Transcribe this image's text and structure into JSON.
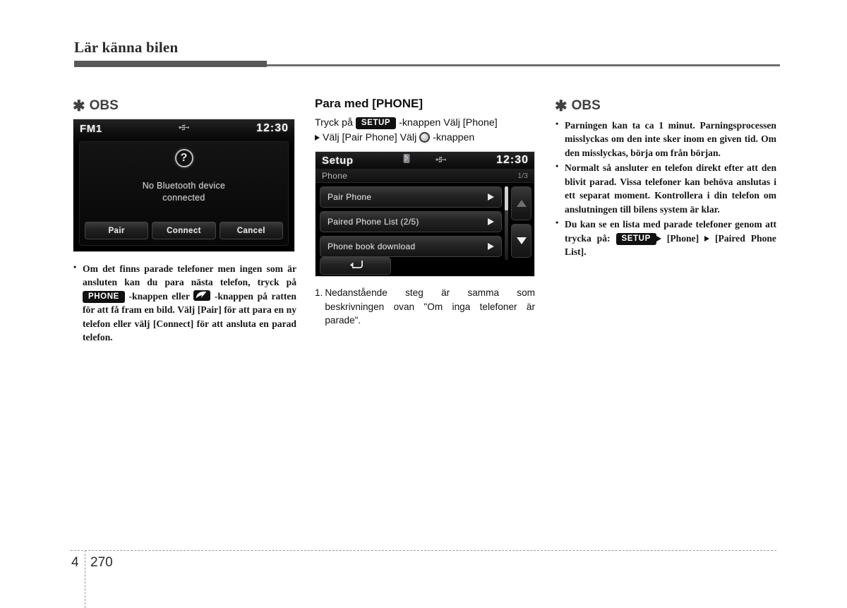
{
  "header": {
    "title": "Lär känna bilen"
  },
  "footer": {
    "chapter": "4",
    "page": "270"
  },
  "left_column": {
    "note_heading": "OBS",
    "note_asterisk": "✱",
    "radio_screen": {
      "title": "FM1",
      "clock": "12:30",
      "status_icons": [
        "usb-icon"
      ],
      "dialog": {
        "icon": "question-mark-icon",
        "icon_glyph": "?",
        "message_line1": "No Bluetooth device",
        "message_line2": "connected",
        "buttons": [
          "Pair",
          "Connect",
          "Cancel"
        ]
      }
    },
    "bullets": [
      {
        "segments": [
          {
            "type": "text",
            "value": "Om det finns parade telefoner men ingen som är ansluten kan du para nästa telefon, tryck på "
          },
          {
            "type": "badge",
            "value": "PHONE"
          },
          {
            "type": "text",
            "value": " -knappen eller "
          },
          {
            "type": "icon",
            "value": "phone-handset-icon"
          },
          {
            "type": "text",
            "value": " -knappen på ratten för att få fram en bild. Välj [Pair] för att para en ny telefon eller välj [Connect] för att ansluta en parad telefon."
          }
        ]
      }
    ]
  },
  "mid_column": {
    "title": "Para med [PHONE]",
    "step_line1_pre": "Tryck på ",
    "step_line1_badge": "SETUP",
    "step_line1_post": " -knappen Välj [Phone]",
    "step_line2_pre": "Välj [Pair Phone] Välj ",
    "step_line2_post": " -knappen",
    "step_line2_icon": "rotary-knob-icon",
    "setup_screen": {
      "title": "Setup",
      "clock": "12:30",
      "status_icons": [
        "bluetooth-icon",
        "usb-icon"
      ],
      "subheader_label": "Phone",
      "subheader_page": "1/3",
      "rows": [
        {
          "label": "Pair Phone",
          "arrow": "chevron-right-icon"
        },
        {
          "label": "Paired Phone List  (2/5)",
          "arrow": "chevron-right-icon"
        },
        {
          "label": "Phone book download",
          "arrow": "chevron-right-icon"
        }
      ],
      "scroll_up": "arrow-up-icon",
      "scroll_down": "arrow-down-icon",
      "back_button": "back-arrow-icon"
    },
    "numbered_note": {
      "number": "1.",
      "text": "Nedanstående steg är samma som beskrivningen ovan \"Om inga telefoner är parade\"."
    }
  },
  "right_column": {
    "note_heading": "OBS",
    "note_asterisk": "✱",
    "bullets": [
      {
        "segments": [
          {
            "type": "text",
            "value": "Parningen kan ta ca 1 minut. Parningsprocessen misslyckas om den inte sker inom en given tid. Om den misslyckas, börja om från början."
          }
        ]
      },
      {
        "segments": [
          {
            "type": "text",
            "value": "Normalt så ansluter en telefon direkt efter att den blivit parad. Vissa telefoner kan behöva anslutas i ett separat moment. Kontrollera i din telefon om anslutningen till bilens system är klar."
          }
        ]
      },
      {
        "segments": [
          {
            "type": "text",
            "value": "Du kan se en lista med parade telefoner genom att trycka på: "
          },
          {
            "type": "badge",
            "value": "SETUP"
          },
          {
            "type": "arrow",
            "value": "triangle-right-icon"
          },
          {
            "type": "text",
            "value": "[Phone] "
          },
          {
            "type": "arrow",
            "value": "triangle-right-icon"
          },
          {
            "type": "text",
            "value": " [Paired Phone List]."
          }
        ]
      }
    ]
  },
  "colors": {
    "header_rule": "#58585a",
    "body_text": "#161616",
    "note_heading": "#404040",
    "badge_bg": "#111111",
    "badge_fg": "#ffffff",
    "lcd_bg": "#000000"
  }
}
